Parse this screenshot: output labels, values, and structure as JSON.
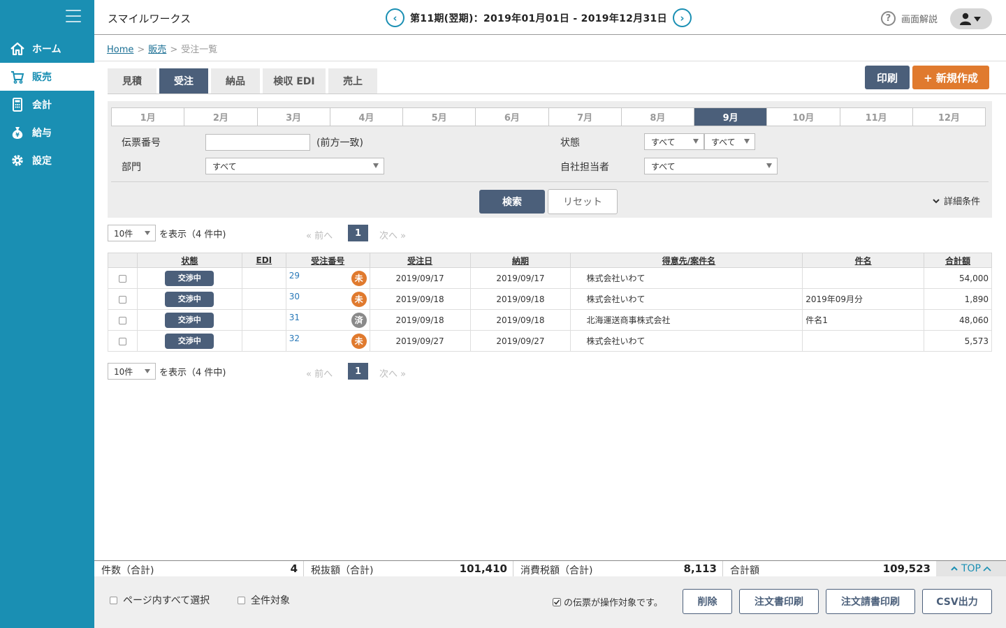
{
  "sidebar": {
    "items": [
      {
        "label": "ホーム",
        "icon": "home-icon"
      },
      {
        "label": "販売",
        "icon": "cart-icon",
        "active": true
      },
      {
        "label": "会計",
        "icon": "calculator-icon"
      },
      {
        "label": "給与",
        "icon": "money-bag-icon"
      },
      {
        "label": "設定",
        "icon": "gear-icon"
      }
    ],
    "color": "#1a8fb3"
  },
  "header": {
    "app_title": "スマイルワークス",
    "period_label": "第11期(翌期)：2019年01月01日 - 2019年12月31日",
    "help_label": "画面解説"
  },
  "breadcrumb": {
    "home": "Home",
    "sales": "販売",
    "current": "受注一覧",
    "sep": ">"
  },
  "tabs": [
    {
      "label": "見積",
      "active": false
    },
    {
      "label": "受注",
      "active": true
    },
    {
      "label": "納品",
      "active": false
    },
    {
      "label": "検収 EDI",
      "active": false
    },
    {
      "label": "売上",
      "active": false
    }
  ],
  "actions": {
    "print": "印刷",
    "new": "+ 新規作成"
  },
  "months": [
    "1月",
    "2月",
    "3月",
    "4月",
    "5月",
    "6月",
    "7月",
    "8月",
    "9月",
    "10月",
    "11月",
    "12月"
  ],
  "active_month": "9月",
  "filter": {
    "slip_no_label": "伝票番号",
    "slip_no_value": "",
    "slip_no_hint": "(前方一致)",
    "status_label": "状態",
    "status_value_1": "すべて",
    "status_value_2": "すべて",
    "dept_label": "部門",
    "dept_value": "すべて",
    "staff_label": "自社担当者",
    "staff_value": "すべて",
    "search": "検索",
    "reset": "リセット",
    "detail": "詳細条件"
  },
  "pager": {
    "per_page": "10件",
    "show_text": "を表示（4 件中)",
    "prev": "«  前へ",
    "page": "1",
    "next": "次へ  »"
  },
  "table": {
    "headers": [
      "",
      "状態",
      "EDI",
      "受注番号",
      "受注日",
      "納期",
      "得意先/案件名",
      "件名",
      "合計額"
    ],
    "rows": [
      {
        "status": "交渉中",
        "edi": "",
        "no": "29",
        "mark": "未",
        "mark_color": "#e07a2e",
        "order_date": "2019/09/17",
        "due": "2019/09/17",
        "customer": "株式会社いわて",
        "subject": "",
        "total": "54,000"
      },
      {
        "status": "交渉中",
        "edi": "",
        "no": "30",
        "mark": "未",
        "mark_color": "#e07a2e",
        "order_date": "2019/09/18",
        "due": "2019/09/18",
        "customer": "株式会社いわて",
        "subject": "2019年09月分",
        "total": "1,890"
      },
      {
        "status": "交渉中",
        "edi": "",
        "no": "31",
        "mark": "済",
        "mark_color": "#8a8a8a",
        "order_date": "2019/09/18",
        "due": "2019/09/18",
        "customer": "北海運送商事株式会社",
        "subject": "件名1",
        "total": "48,060"
      },
      {
        "status": "交渉中",
        "edi": "",
        "no": "32",
        "mark": "未",
        "mark_color": "#e07a2e",
        "order_date": "2019/09/27",
        "due": "2019/09/27",
        "customer": "株式会社いわて",
        "subject": "",
        "total": "5,573"
      }
    ]
  },
  "totals": {
    "count_label": "件数（合計)",
    "count": "4",
    "pretax_label": "税抜額（合計)",
    "pretax": "101,410",
    "tax_label": "消費税額（合計)",
    "tax": "8,113",
    "total_label": "合計額",
    "total": "109,523",
    "top": "TOP"
  },
  "footer": {
    "select_page": "ページ内すべて選択",
    "select_all": "全件対象",
    "notice": "の伝票が操作対象です。",
    "delete": "削除",
    "order_print": "注文書印刷",
    "order_req_print": "注文請書印刷",
    "csv": "CSV出力"
  },
  "colors": {
    "primary": "#4b5f7a",
    "accent": "#e07a2e",
    "link": "#2878b8"
  }
}
